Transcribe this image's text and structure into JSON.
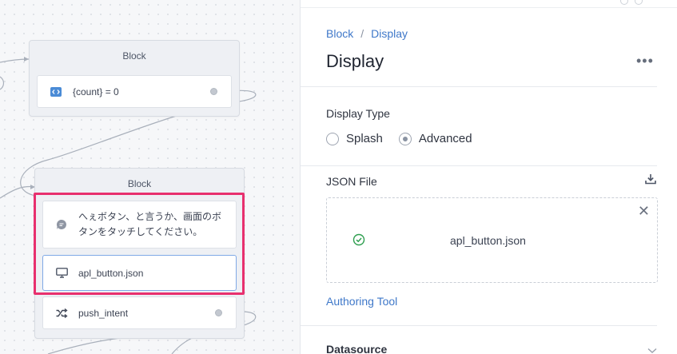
{
  "canvas": {
    "block1": {
      "title": "Block",
      "steps": [
        {
          "label": "{count} = 0",
          "icon": "code-icon"
        }
      ]
    },
    "block2": {
      "title": "Block",
      "steps": [
        {
          "label_line1": "へぇボタン、と言うか、画面のボ",
          "label_line2": "タンをタッチしてください。",
          "icon": "speech-bubble-icon"
        },
        {
          "label": "apl_button.json",
          "icon": "monitor-icon"
        },
        {
          "label": "push_intent",
          "icon": "shuffle-icon"
        }
      ]
    },
    "colors": {
      "highlight": "#e8306e",
      "selected_border": "#7fa9e6"
    }
  },
  "panel": {
    "breadcrumb": {
      "parent": "Block",
      "separator": "/",
      "current": "Display"
    },
    "title": "Display",
    "more": "•••",
    "display_type": {
      "label": "Display Type",
      "options": [
        "Splash",
        "Advanced"
      ],
      "selected": "Advanced"
    },
    "json_file": {
      "label": "JSON File",
      "filename": "apl_button.json",
      "close": "✕"
    },
    "authoring_tool": "Authoring Tool",
    "datasource": {
      "label": "Datasource"
    },
    "colors": {
      "link": "#3f78c9",
      "success": "#2e9e4f"
    }
  }
}
